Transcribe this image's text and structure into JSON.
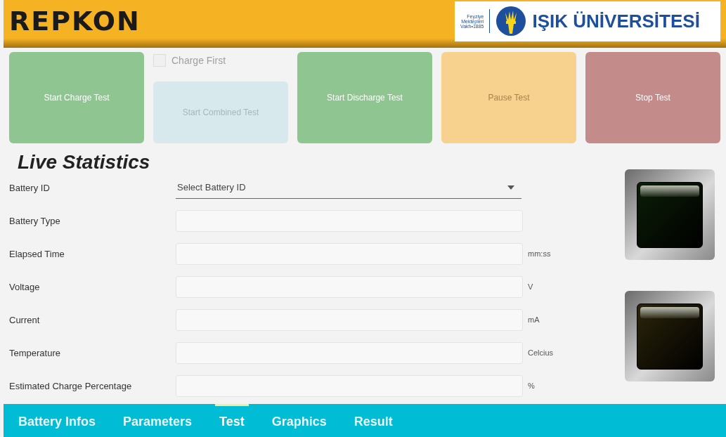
{
  "header": {
    "title": "REPKON",
    "logo": {
      "foundation": [
        "Feyziye",
        "Mektepleri",
        "Vakfı•1885"
      ],
      "name": "IŞIK ÜNİVERSİTESİ"
    }
  },
  "controls": [
    {
      "kind": "button",
      "label": "Start Charge Test",
      "color": "#8fc590",
      "disabled": false
    },
    {
      "kind": "combined",
      "checkbox": {
        "label": "Charge First",
        "checked": false
      },
      "label": "Start Combined Test",
      "color": "#d8e9ee",
      "disabled": true
    },
    {
      "kind": "button",
      "label": "Start Discharge Test",
      "color": "#8fc590",
      "disabled": false
    },
    {
      "kind": "button",
      "label": "Pause Test",
      "color": "#f7d28f",
      "disabled": true
    },
    {
      "kind": "button",
      "label": "Stop Test",
      "color": "#c48b8b",
      "disabled": false
    }
  ],
  "live_statistics": {
    "title": "Live Statistics",
    "rows": [
      {
        "kind": "dropdown",
        "label": "Battery ID",
        "placeholder": "Select Battery ID"
      },
      {
        "kind": "text",
        "label": "Battery Type"
      },
      {
        "kind": "text",
        "label": "Elapsed Time",
        "unit": "mm:ss"
      },
      {
        "kind": "text",
        "label": "Voltage",
        "unit": "V"
      },
      {
        "kind": "text",
        "label": "Current",
        "unit": "mA"
      },
      {
        "kind": "text",
        "label": "Temperature",
        "unit": "Celcius"
      },
      {
        "kind": "text",
        "label": "Estimated Charge Percentage",
        "unit": "%"
      }
    ],
    "lamps": [
      {
        "color": "#0b1e06",
        "on": false
      },
      {
        "color": "#2b250a",
        "on": false
      }
    ]
  },
  "tabs": [
    {
      "label": "Battery Infos",
      "selected": false
    },
    {
      "label": "Parameters",
      "selected": false
    },
    {
      "label": "Test",
      "selected": true
    },
    {
      "label": "Graphics",
      "selected": false
    },
    {
      "label": "Result",
      "selected": false
    }
  ]
}
